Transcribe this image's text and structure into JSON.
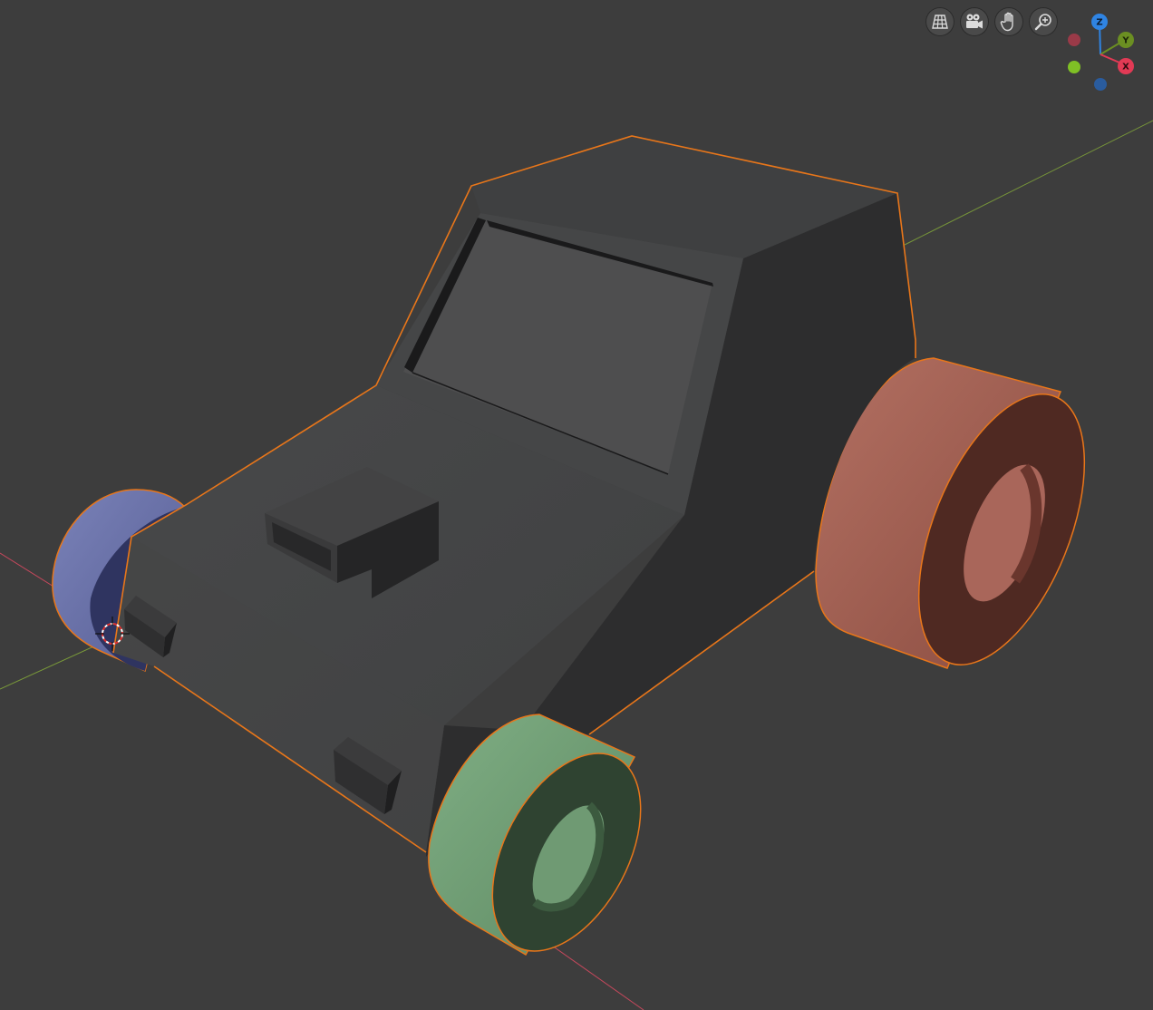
{
  "navigation": {
    "buttons": [
      {
        "icon": "perspective-grid-icon"
      },
      {
        "icon": "camera-view-icon"
      },
      {
        "icon": "hand-pan-icon"
      },
      {
        "icon": "zoom-magnifier-icon"
      }
    ]
  },
  "gizmo": {
    "axis_z": "Z",
    "axis_y": "Y",
    "axis_x": "X",
    "colors": {
      "z": "#2f84e3",
      "y": "#6b8f22",
      "x": "#e23a55",
      "neg_x": "#9a3a48",
      "neg_y": "#7fc025",
      "neg_z": "#2a5c9e"
    }
  },
  "scene": {
    "selection_outline_color": "#e8761a",
    "body_color": "#4a4a4b",
    "wheels": [
      {
        "name": "front-left",
        "color": "#6f77ad"
      },
      {
        "name": "front-right",
        "color": "#78a37b"
      },
      {
        "name": "rear-right",
        "color": "#b06d60"
      }
    ],
    "axis_lines": {
      "x_color": "#c5485c",
      "y_color": "#7a9a3a"
    }
  }
}
